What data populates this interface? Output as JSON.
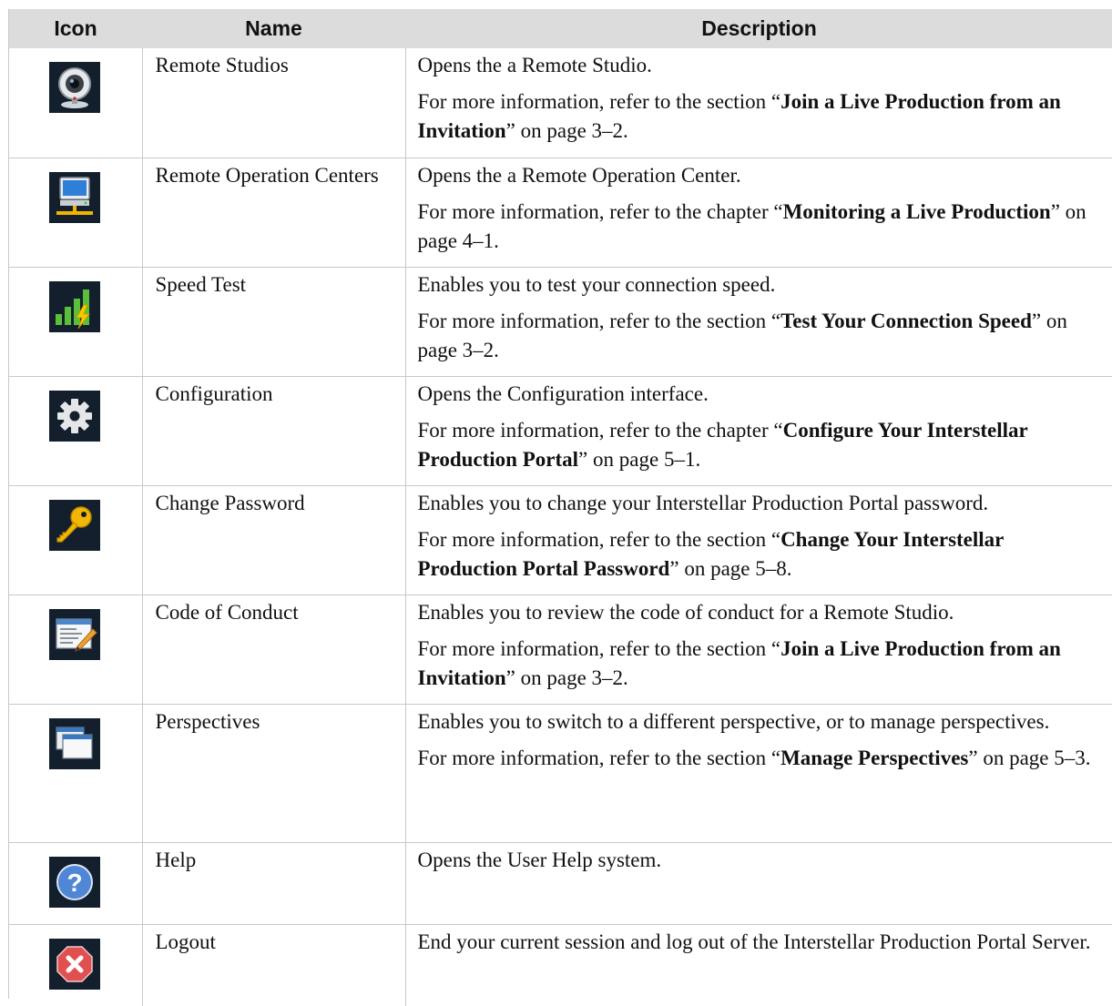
{
  "headers": {
    "icon": "Icon",
    "name": "Name",
    "description": "Description"
  },
  "text": {
    "more_prefix": "For more information, refer to the",
    "on_page": "on page"
  },
  "rows": [
    {
      "icon": "webcam-icon",
      "name": "Remote Studios",
      "desc": "Opens the a Remote Studio.",
      "ref_kind": "section",
      "ref_title": "Join a Live Production from an Invitation",
      "ref_page": "3–2"
    },
    {
      "icon": "computer-network-icon",
      "name": "Remote Operation Centers",
      "desc": "Opens the a Remote Operation Center.",
      "ref_kind": "chapter",
      "ref_title": "Monitoring a Live Production",
      "ref_page": "4–1"
    },
    {
      "icon": "signal-bars-icon",
      "name": "Speed Test",
      "desc": "Enables you to test your connection speed.",
      "ref_kind": "section",
      "ref_title": "Test Your Connection Speed",
      "ref_page": "3–2"
    },
    {
      "icon": "gear-icon",
      "name": "Configuration",
      "desc": "Opens the Configuration interface.",
      "ref_kind": "chapter",
      "ref_title": "Configure Your Interstellar Production Portal",
      "ref_page": "5–1"
    },
    {
      "icon": "key-icon",
      "name": "Change Password",
      "desc": "Enables you to change your Interstellar Production Portal password.",
      "ref_kind": "section",
      "ref_title": "Change Your Interstellar Production Portal Password",
      "ref_page": "5–8"
    },
    {
      "icon": "document-pencil-icon",
      "name": "Code of Conduct",
      "desc": "Enables you to review the code of conduct for a Remote Studio.",
      "ref_kind": "section",
      "ref_title": "Join a Live Production from an Invitation",
      "ref_page": "3–2"
    },
    {
      "icon": "windows-icon",
      "name": "Perspectives",
      "desc": "Enables you to switch to a different perspective, or to manage perspectives.",
      "ref_kind": "section",
      "ref_title": "Manage Perspectives",
      "ref_page": "5–3"
    },
    {
      "icon": "help-icon",
      "name": "Help",
      "desc": "Opens the User Help system."
    },
    {
      "icon": "logout-icon",
      "name": "Logout",
      "desc": "End your current session and log out of the Interstellar Production Portal Server."
    }
  ]
}
